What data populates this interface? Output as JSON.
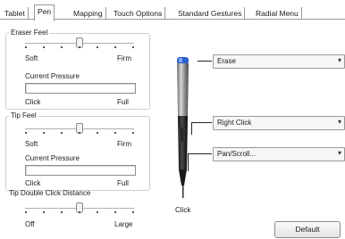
{
  "tabs": [
    "Tablet",
    "Pen",
    "Mapping",
    "Touch Options",
    "Standard Gestures",
    "Radial Menu"
  ],
  "eraser_feel": {
    "title": "Eraser Feel",
    "min_label": "Soft",
    "max_label": "Firm",
    "pressure_label": "Current Pressure",
    "pressure_min": "Click",
    "pressure_max": "Full",
    "slider_fraction": 0.5
  },
  "tip_feel": {
    "title": "Tip Feel",
    "min_label": "Soft",
    "max_label": "Firm",
    "pressure_label": "Current Pressure",
    "pressure_min": "Click",
    "pressure_max": "Full",
    "slider_fraction": 0.5
  },
  "double_click": {
    "title": "Tip Double Click Distance",
    "min_label": "Off",
    "max_label": "Large",
    "slider_fraction": 0.5
  },
  "pen_buttons": {
    "eraser": "Erase",
    "upper_side": "Right Click",
    "lower_side": "Pan/Scroll...",
    "tip": "Click"
  },
  "default_button": "Default",
  "colors": {
    "accent_eraser": "#2a5fd0",
    "border": "#9a9a9a"
  }
}
